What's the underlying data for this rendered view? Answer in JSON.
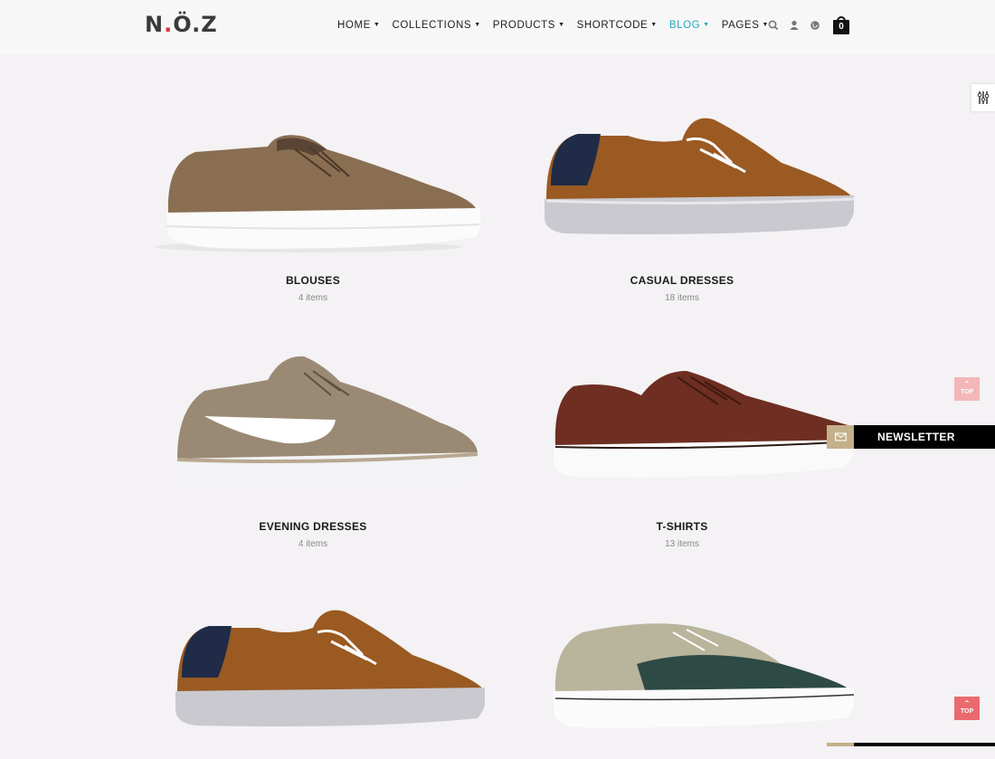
{
  "brand": {
    "logo_text_1": "N",
    "logo_dot": ".",
    "logo_text_2": "Ö",
    "logo_text_3": ".Z"
  },
  "nav": {
    "items": [
      {
        "label": "HOME"
      },
      {
        "label": "COLLECTIONS"
      },
      {
        "label": "PRODUCTS"
      },
      {
        "label": "SHORTCODE"
      },
      {
        "label": "BLOG"
      },
      {
        "label": "PAGES"
      }
    ],
    "active_index": 4
  },
  "header_icons": {
    "search": "search-icon",
    "user": "user-icon",
    "language": "globe-icon",
    "cart": "shopping-bag-icon",
    "cart_count": "0"
  },
  "colors": {
    "accent": "#22a7b8",
    "newsletter_accent": "#c4b08a",
    "top_button": "#ea6a6e"
  },
  "collections": [
    {
      "title": "BLOUSES",
      "count": "4 items",
      "shoe": "brown-suede"
    },
    {
      "title": "CASUAL DRESSES",
      "count": "18 items",
      "shoe": "tan-navy"
    },
    {
      "title": "EVENING DRESSES",
      "count": "4 items",
      "shoe": "grey-swoosh"
    },
    {
      "title": "T-SHIRTS",
      "count": "13 items",
      "shoe": "brown-leather"
    },
    {
      "title": "",
      "count": "",
      "shoe": "tan-navy"
    },
    {
      "title": "",
      "count": "",
      "shoe": "green-beige"
    }
  ],
  "widgets": {
    "newsletter_label": "NEWSLETTER",
    "top_label": "TOP",
    "settings_icon": "sliders-icon",
    "newsletter_icon": "envelope-icon"
  }
}
